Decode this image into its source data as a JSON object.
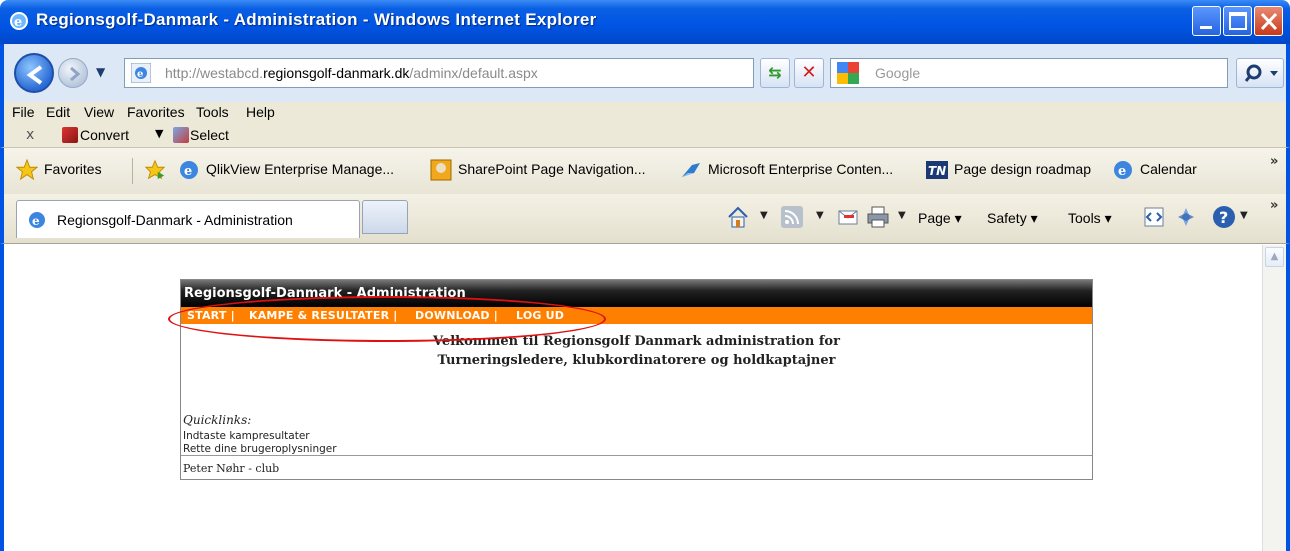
{
  "window": {
    "title": "Regionsgolf-Danmark - Administration - Windows Internet Explorer"
  },
  "address": {
    "url_prefix": "http://westabcd.",
    "url_host": "regionsgolf-danmark.dk",
    "url_path": "/adminx/default.aspx"
  },
  "search": {
    "placeholder": "Google"
  },
  "menu": {
    "items": [
      "File",
      "Edit",
      "View",
      "Favorites",
      "Tools",
      "Help"
    ]
  },
  "toolbar": {
    "close_glyph": "x",
    "convert_label": "Convert",
    "select_label": "Select"
  },
  "favorites": {
    "label": "Favorites",
    "links": [
      "QlikView Enterprise Manage...",
      "SharePoint Page Navigation...",
      "Microsoft Enterprise Conten...",
      "Page design roadmap",
      "Calendar"
    ],
    "overflow": "»"
  },
  "tabs": {
    "active_label": "Regionsgolf-Danmark - Administration"
  },
  "commandbar": {
    "page_label": "Page",
    "safety_label": "Safety",
    "tools_label": "Tools",
    "overflow": "»"
  },
  "webpage": {
    "header_title": "Regionsgolf-Danmark - Administration",
    "nav": [
      "START  |",
      "KAMPE & RESULTATER  |",
      "DOWNLOAD  |",
      "LOG UD"
    ],
    "welcome_line1": "Velkommen til Regionsgolf Danmark administration for",
    "welcome_line2": "Turneringsledere, klubkordinatorere og holdkaptajner",
    "quicklinks_label": "Quicklinks:",
    "quicklinks": [
      "Indtaste kampresultater",
      "Rette dine brugeroplysninger"
    ],
    "footer": "Peter Nøhr - club"
  },
  "annotation": {
    "color": "#e01010"
  }
}
